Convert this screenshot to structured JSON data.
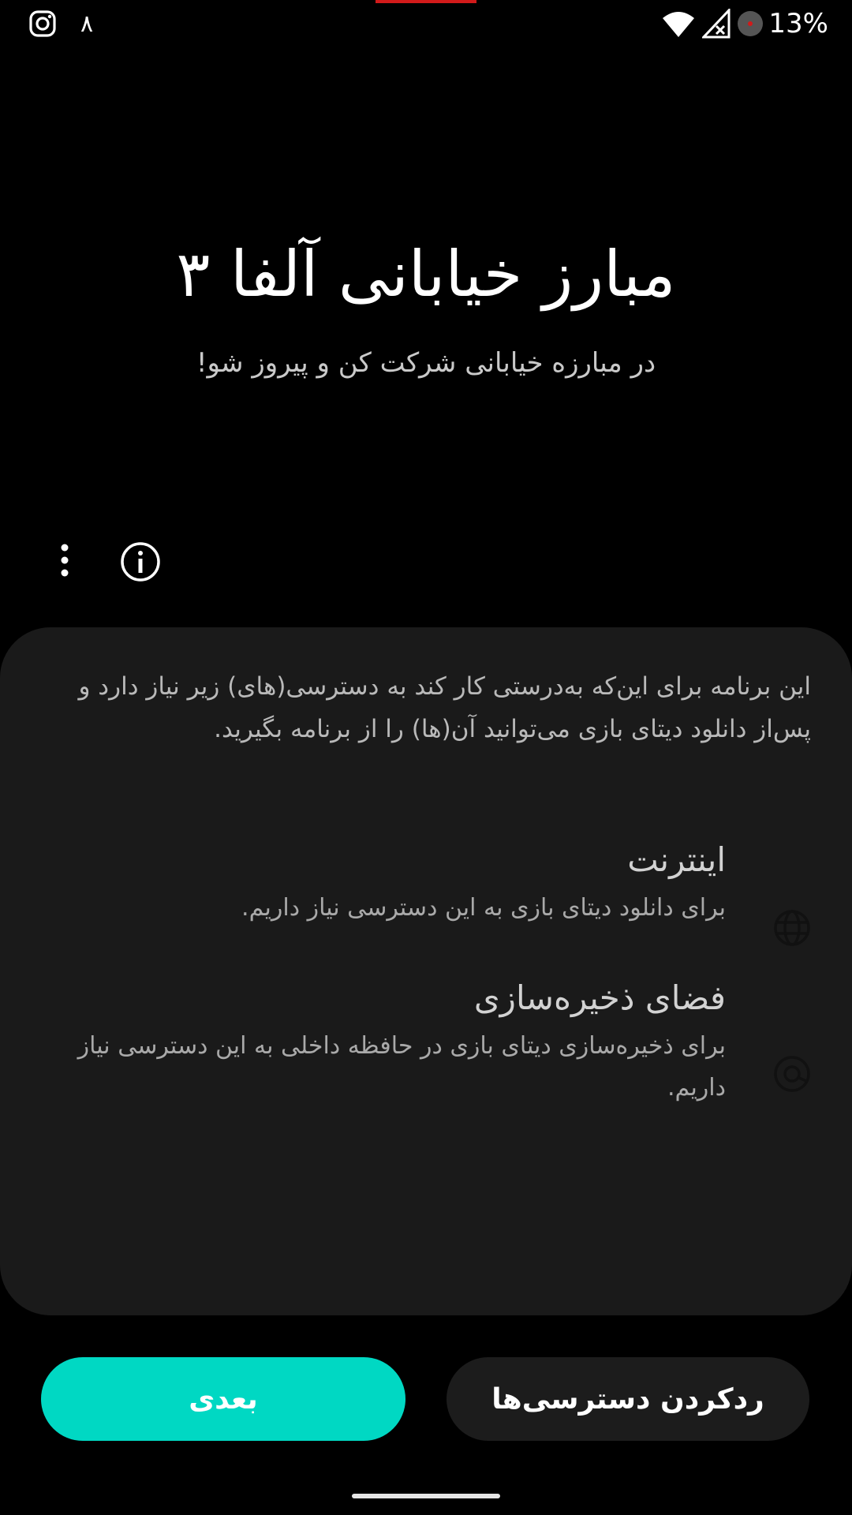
{
  "status_bar": {
    "notification_count": "۸",
    "battery_percent": "13%",
    "icons": [
      "instagram-icon",
      "wifi-icon",
      "cellular-no-signal-icon",
      "recording-dot-icon"
    ]
  },
  "app": {
    "title": "مبارز خیابانی آلفا ۳",
    "subtitle": "در مبارزه خیابانی شرکت کن و پیروز شو!"
  },
  "toolbar": {
    "icons": [
      "more-vertical-icon",
      "info-icon"
    ]
  },
  "permissions": {
    "description": "این برنامه برای این‌که به‌درستی کار کند به دسترسی(های) زیر نیاز دارد و پس‌از دانلود دیتای بازی می‌توانید آن(ها) را از برنامه بگیرید.",
    "items": [
      {
        "title": "اینترنت",
        "description": "برای دانلود دیتای بازی به این دسترسی نیاز داریم.",
        "icon": "globe-icon"
      },
      {
        "title": "فضای ذخیره‌سازی",
        "description": "برای ذخیره‌سازی دیتای بازی در حافظه داخلی به این دسترسی نیاز داریم.",
        "icon": "storage-icon"
      }
    ]
  },
  "buttons": {
    "next_label": "بعدی",
    "deny_label": "ردکردن دسترسی‌ها"
  },
  "colors": {
    "accent": "#00d8c3",
    "background": "#000000",
    "card": "#1a1a1a"
  }
}
